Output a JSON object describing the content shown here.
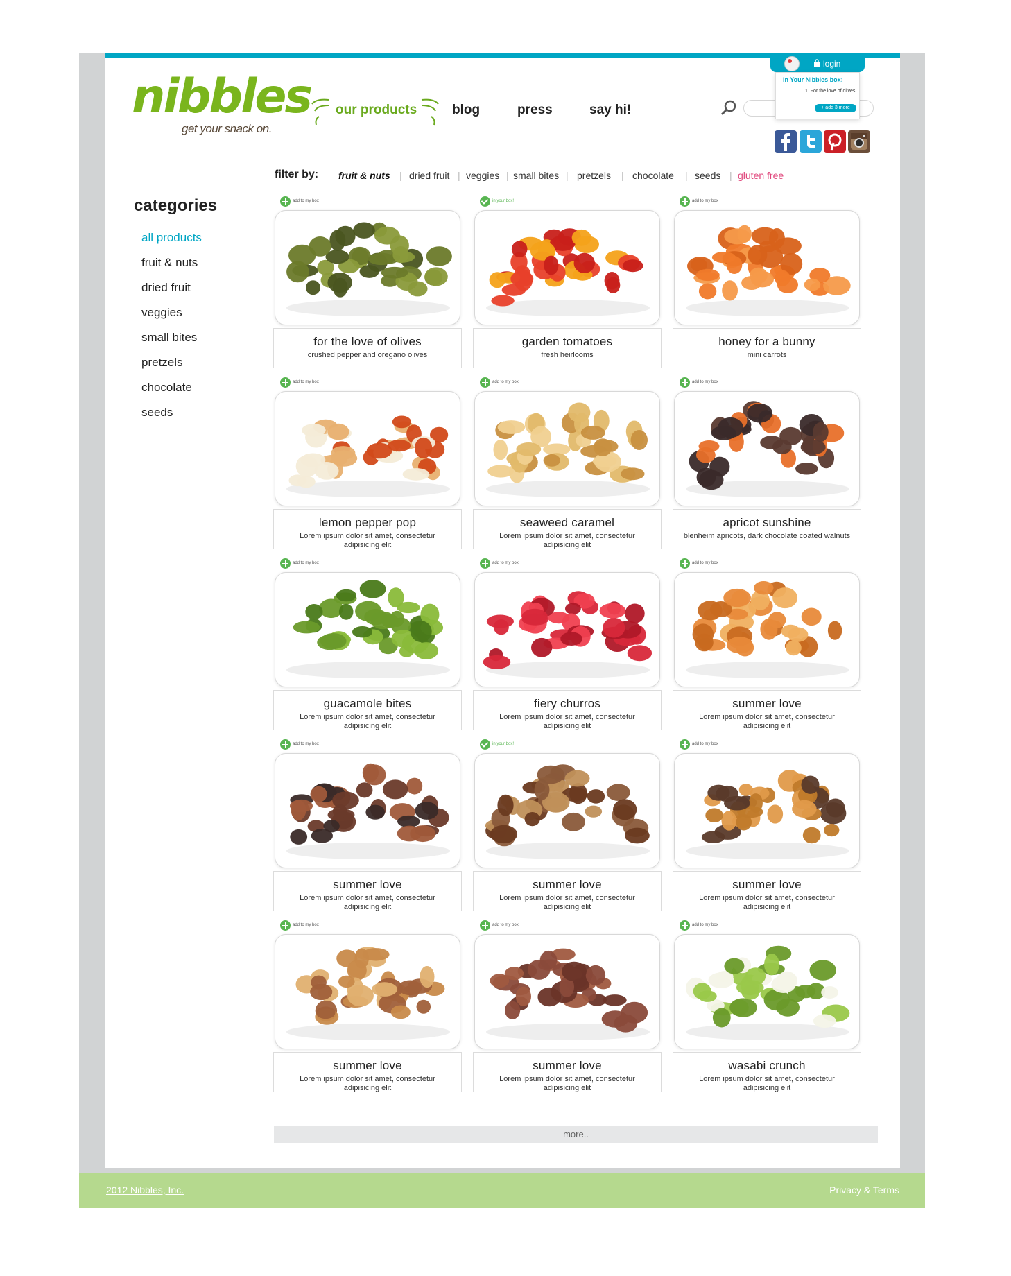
{
  "brand": {
    "name": "nibbles",
    "tagline": "get your snack on.",
    "accent": "#00a6c4",
    "green": "#7ab51d"
  },
  "nav": {
    "items": [
      "our products",
      "blog",
      "press",
      "say hi!"
    ],
    "active": "our products"
  },
  "search": {
    "placeholder": "",
    "icon": "search-icon"
  },
  "login": {
    "label": "login",
    "box_title": "In Your Nibbles box:",
    "box_item": "1. For the love of olives",
    "add_more": "+ add 3 more"
  },
  "social": [
    "facebook-icon",
    "twitter-icon",
    "pinterest-icon",
    "instagram-icon"
  ],
  "filter": {
    "label": "filter by:",
    "items": [
      "fruit & nuts",
      "dried fruit",
      "veggies",
      "small bites",
      "pretzels",
      "chocolate",
      "seeds",
      "gluten free"
    ],
    "active": "fruit & nuts",
    "highlight_color": "#e0457b"
  },
  "categories": {
    "title": "categories",
    "items": [
      "all products",
      "fruit & nuts",
      "dried fruit",
      "veggies",
      "small bites",
      "pretzels",
      "chocolate",
      "seeds"
    ],
    "active": "all products"
  },
  "add_label": "add to my box",
  "in_box_label": "in your box!",
  "products": [
    {
      "name": "for the love of olives",
      "desc": "crushed pepper and oregano olives",
      "in_box": false
    },
    {
      "name": "garden tomatoes",
      "desc": "fresh heirlooms",
      "in_box": true
    },
    {
      "name": "honey for a bunny",
      "desc": "mini carrots",
      "in_box": false
    },
    {
      "name": "lemon pepper pop",
      "desc": "Lorem ipsum dolor sit amet, consectetur adipisicing elit",
      "in_box": false
    },
    {
      "name": "seaweed caramel",
      "desc": "Lorem ipsum dolor sit amet, consectetur adipisicing elit",
      "in_box": false
    },
    {
      "name": "apricot sunshine",
      "desc": "blenheim apricots, dark chocolate coated walnuts",
      "in_box": false
    },
    {
      "name": "guacamole bites",
      "desc": "Lorem ipsum dolor sit amet, consectetur adipisicing elit",
      "in_box": false
    },
    {
      "name": "fiery churros",
      "desc": "Lorem ipsum dolor sit amet, consectetur adipisicing elit",
      "in_box": false
    },
    {
      "name": "summer love",
      "desc": "Lorem ipsum dolor sit amet, consectetur adipisicing elit",
      "in_box": false
    },
    {
      "name": "summer love",
      "desc": "Lorem ipsum dolor sit amet, consectetur adipisicing elit",
      "in_box": false
    },
    {
      "name": "summer love",
      "desc": "Lorem ipsum dolor sit amet, consectetur adipisicing elit",
      "in_box": true
    },
    {
      "name": "summer love",
      "desc": "Lorem ipsum dolor sit amet, consectetur adipisicing elit",
      "in_box": false
    },
    {
      "name": "summer love",
      "desc": "Lorem ipsum dolor sit amet, consectetur adipisicing elit",
      "in_box": false
    },
    {
      "name": "summer love",
      "desc": "Lorem ipsum dolor sit amet, consectetur adipisicing elit",
      "in_box": false
    },
    {
      "name": "wasabi crunch",
      "desc": "Lorem ipsum dolor sit amet, consectetur adipisicing elit",
      "in_box": false
    }
  ],
  "more_label": "more..",
  "footer": {
    "copyright": "2012 Nibbles, Inc.",
    "privacy": "Privacy & Terms"
  }
}
